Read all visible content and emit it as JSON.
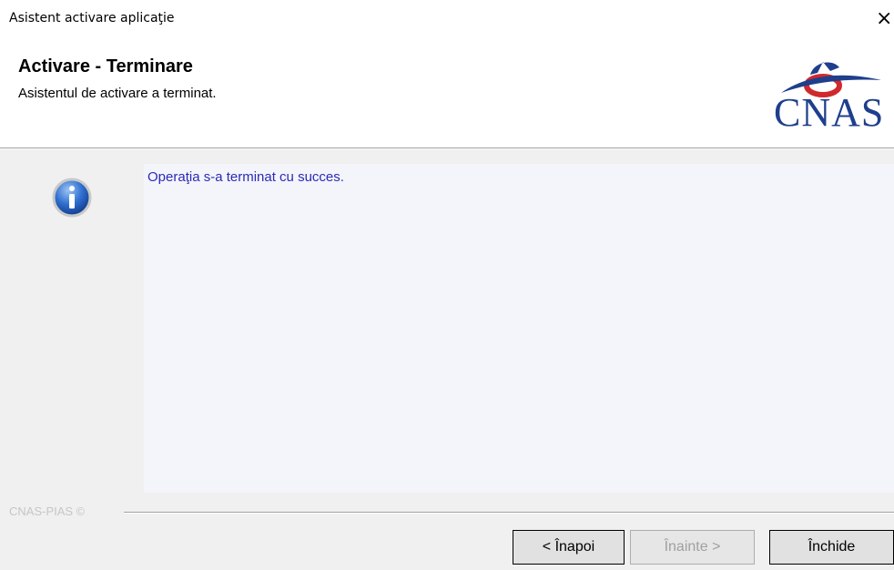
{
  "window": {
    "title": "Asistent activare aplicaţie",
    "close_glyph": "×"
  },
  "header": {
    "heading": "Activare - Terminare",
    "subheading": "Asistentul de activare a terminat.",
    "logo_text": "CNAS",
    "logo_colors": {
      "red": "#d0282c",
      "blue": "#1f3f8c"
    }
  },
  "content": {
    "icon": "info-icon",
    "message": "Operaţia s-a terminat cu succes.",
    "message_color": "#2b2bb4"
  },
  "footer": {
    "label": "CNAS-PIAS ©"
  },
  "buttons": {
    "back": {
      "label": "< Înapoi",
      "enabled": true
    },
    "next": {
      "label": "Înainte >",
      "enabled": false
    },
    "close": {
      "label": "Închide",
      "enabled": true
    }
  }
}
